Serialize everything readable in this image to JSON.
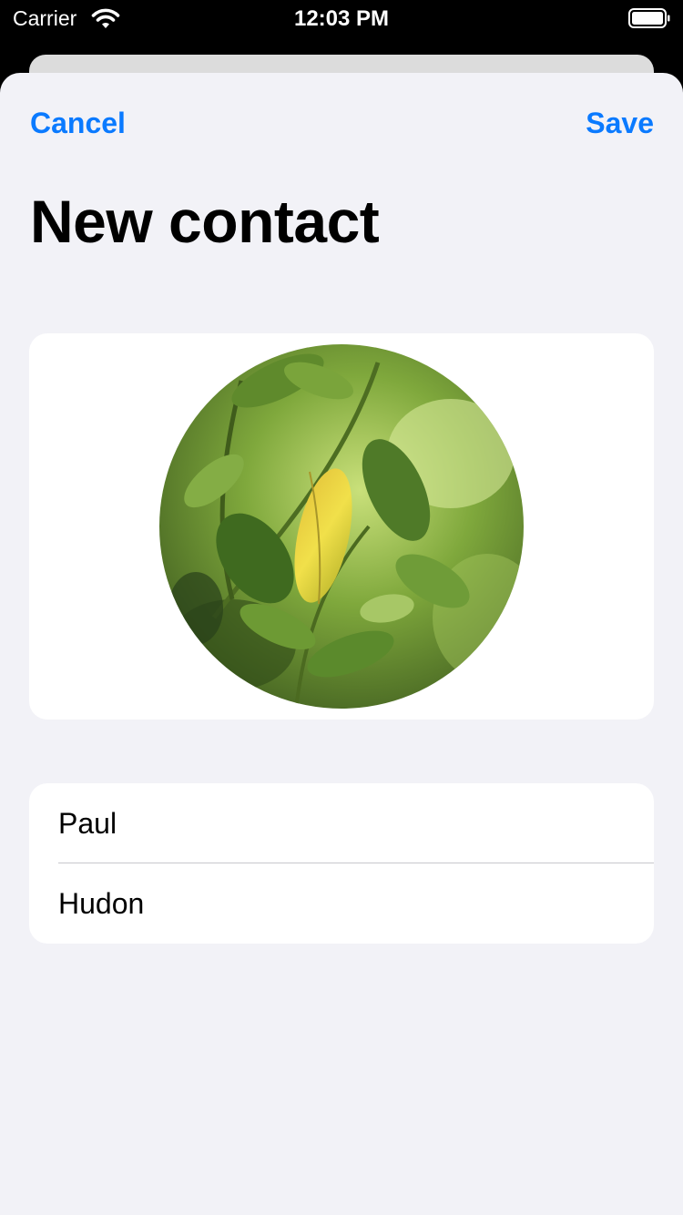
{
  "status_bar": {
    "carrier": "Carrier",
    "time": "12:03 PM",
    "icons": [
      "wifi-icon",
      "battery-icon"
    ]
  },
  "nav": {
    "cancel_label": "Cancel",
    "save_label": "Save"
  },
  "page": {
    "title": "New contact"
  },
  "avatar": {
    "description_icon": "contact-photo"
  },
  "fields": {
    "first_name": "Paul",
    "last_name": "Hudon"
  },
  "colors": {
    "accent": "#0a7aff",
    "background": "#f2f2f7",
    "card": "#ffffff"
  }
}
